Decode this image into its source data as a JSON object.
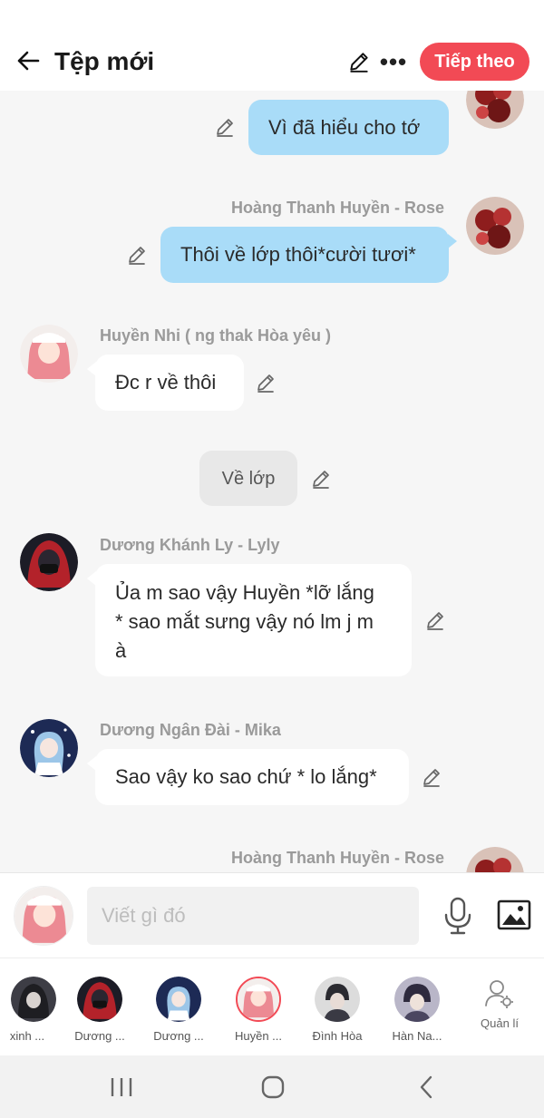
{
  "header": {
    "title": "Tệp mới",
    "next_label": "Tiếp theo",
    "more_label": "•••"
  },
  "messages": [
    {
      "type": "outgoing",
      "text": "Vì đã hiểu cho tớ"
    },
    {
      "type": "outgoing",
      "sender": "Hoàng Thanh Huyền - Rose",
      "text": "Thôi về lớp thôi*cười tươi*"
    },
    {
      "type": "incoming",
      "sender": "Huyền Nhi ( ng thak Hòa yêu )",
      "text": "Đc r về thôi"
    },
    {
      "type": "narration",
      "text": "Về lớp"
    },
    {
      "type": "incoming",
      "sender": "Dương Khánh Ly - Lyly",
      "lines": [
        "Ủa m sao vậy Huyền *lỡ lắng",
        "* sao mắt sưng vậy nó lm j m",
        "à"
      ]
    },
    {
      "type": "incoming",
      "sender": "Dương Ngân Đài - Mika",
      "text": "Sao vậy ko sao chứ * lo lắng*"
    },
    {
      "type": "outgoing",
      "sender": "Hoàng Thanh Huyền - Rose"
    }
  ],
  "input": {
    "placeholder": "Viết gì đó"
  },
  "participants": [
    {
      "label": "xinh ...",
      "avatar": "dark-hair-avatar"
    },
    {
      "label": "Dương ...",
      "avatar": "red-hood-avatar"
    },
    {
      "label": "Dương ...",
      "avatar": "blue-hair-avatar"
    },
    {
      "label": "Huyền ...",
      "avatar": "pink-hair-avatar",
      "selected": true
    },
    {
      "label": "Đình Hòa",
      "avatar": "boy-avatar"
    },
    {
      "label": "Hàn Na...",
      "avatar": "dark-boy-avatar"
    }
  ],
  "manage": {
    "label": "Quản lí"
  },
  "colors": {
    "accent": "#f24a55",
    "outgoing_bubble": "#a9dcf8",
    "incoming_bubble": "#ffffff",
    "narration_bubble": "#e8e8e8",
    "chat_background": "#f6f6f6"
  },
  "icons": [
    "back-arrow-icon",
    "pencil-icon",
    "more-icon",
    "microphone-icon",
    "image-icon",
    "manage-user-icon",
    "recents-icon",
    "home-icon",
    "back-chevron-icon"
  ]
}
